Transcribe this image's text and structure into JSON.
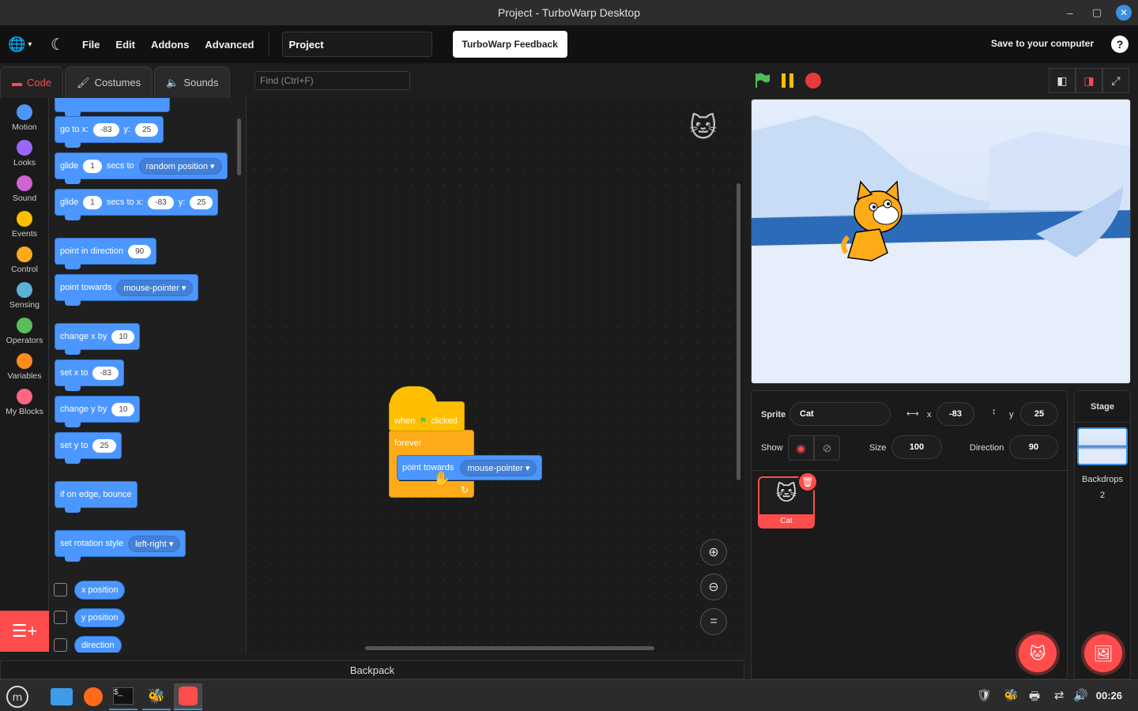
{
  "window": {
    "title": "Project - TurboWarp Desktop"
  },
  "menubar": {
    "items": [
      "File",
      "Edit",
      "Addons",
      "Advanced"
    ],
    "project_title": "Project",
    "feedback": "TurboWarp Feedback",
    "save": "Save to your computer",
    "help": "?"
  },
  "tabs": {
    "code": "Code",
    "costumes": "Costumes",
    "sounds": "Sounds"
  },
  "find": {
    "placeholder": "Find (Ctrl+F)"
  },
  "categories": [
    {
      "label": "Motion",
      "color": "#4c97ff"
    },
    {
      "label": "Looks",
      "color": "#9966ff"
    },
    {
      "label": "Sound",
      "color": "#cf63cf"
    },
    {
      "label": "Events",
      "color": "#ffbf00"
    },
    {
      "label": "Control",
      "color": "#ffab19"
    },
    {
      "label": "Sensing",
      "color": "#5cb1d6"
    },
    {
      "label": "Operators",
      "color": "#59c059"
    },
    {
      "label": "Variables",
      "color": "#ff8c1a"
    },
    {
      "label": "My Blocks",
      "color": "#ff6680"
    }
  ],
  "palette": {
    "goto": {
      "a": "go to x:",
      "x": "-83",
      "b": "y:",
      "y": "25"
    },
    "glide_random": {
      "a": "glide",
      "n": "1",
      "b": "secs to",
      "target": "random position"
    },
    "glide_xy": {
      "a": "glide",
      "n": "1",
      "b": "secs to x:",
      "x": "-83",
      "c": "y:",
      "y": "25"
    },
    "point_dir": {
      "a": "point in direction",
      "v": "90"
    },
    "point_towards": {
      "a": "point towards",
      "target": "mouse-pointer"
    },
    "change_x": {
      "a": "change x by",
      "v": "10"
    },
    "set_x": {
      "a": "set x to",
      "v": "-83"
    },
    "change_y": {
      "a": "change y by",
      "v": "10"
    },
    "set_y": {
      "a": "set y to",
      "v": "25"
    },
    "bounce": "if on edge, bounce",
    "rotation": {
      "a": "set rotation style",
      "v": "left-right"
    },
    "reporters": [
      "x position",
      "y position",
      "direction"
    ]
  },
  "script": {
    "hat": {
      "a": "when",
      "b": "clicked"
    },
    "forever": "forever",
    "point": {
      "a": "point towards",
      "target": "mouse-pointer"
    }
  },
  "backpack": "Backpack",
  "sprite": {
    "label": "Sprite",
    "name": "Cat",
    "x_label": "x",
    "x": "-83",
    "y_label": "y",
    "y": "25",
    "show_label": "Show",
    "size_label": "Size",
    "size": "100",
    "direction_label": "Direction",
    "direction": "90",
    "tile_name": "Cat"
  },
  "stage_panel": {
    "title": "Stage",
    "backdrops_label": "Backdrops",
    "backdrops_count": "2"
  },
  "taskbar": {
    "clock": "00:26"
  },
  "colors": {
    "accent": "#ff4c4c",
    "motion": "#4c97ff",
    "events": "#ffbf00",
    "control": "#ffab19"
  }
}
